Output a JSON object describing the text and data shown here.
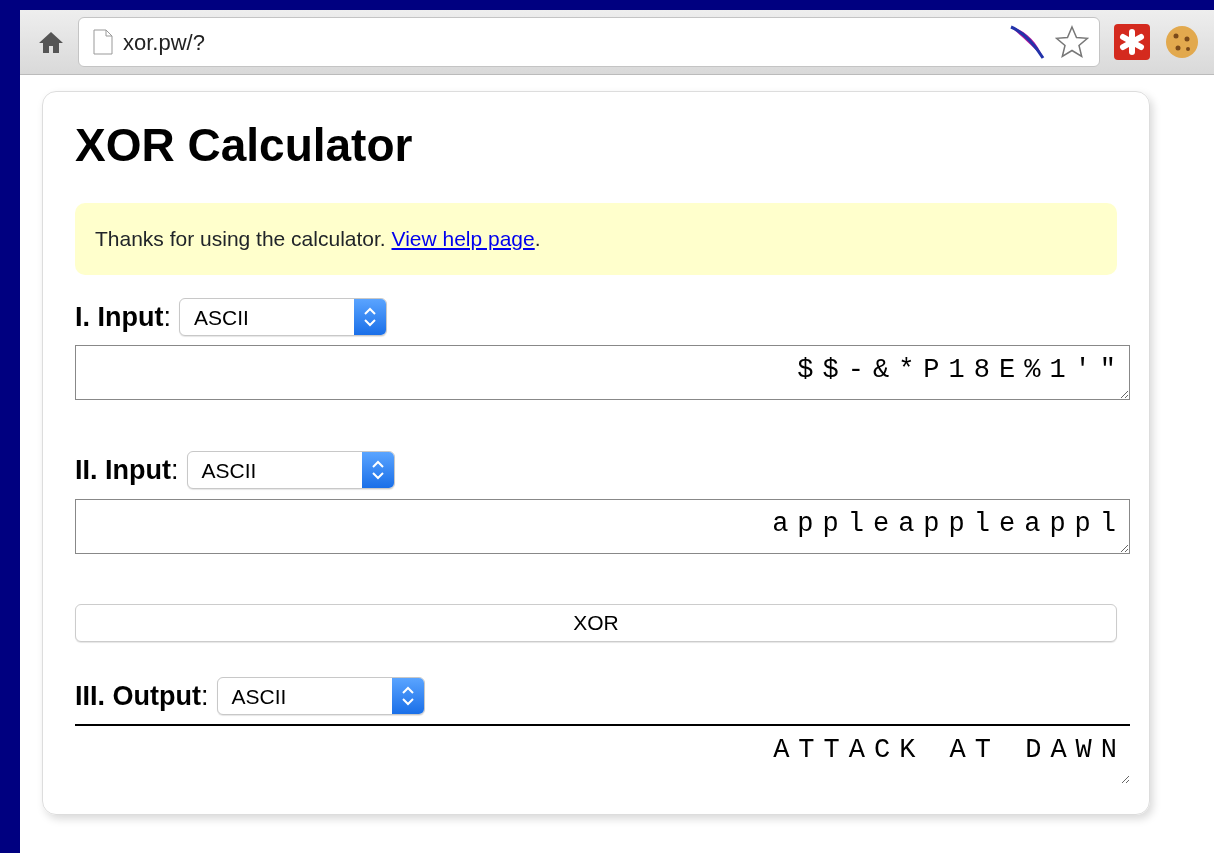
{
  "browser": {
    "url": "xor.pw/?"
  },
  "title": "XOR Calculator",
  "notice": {
    "text": "Thanks for using the calculator. ",
    "link": "View help page",
    "after": "."
  },
  "sections": [
    {
      "kind": "input",
      "label": "**I. Input**:",
      "format": "ASCII",
      "value": "$$-&*P18E%1'\""
    },
    {
      "kind": "input",
      "label": "**II. Input**:",
      "format": "ASCII",
      "value": "appleappleappl"
    },
    {
      "kind": "button",
      "text": "XOR"
    },
    {
      "kind": "output",
      "label": "**III. Output**:",
      "format": "ASCII",
      "value": "ATTACK AT DAWN"
    }
  ]
}
